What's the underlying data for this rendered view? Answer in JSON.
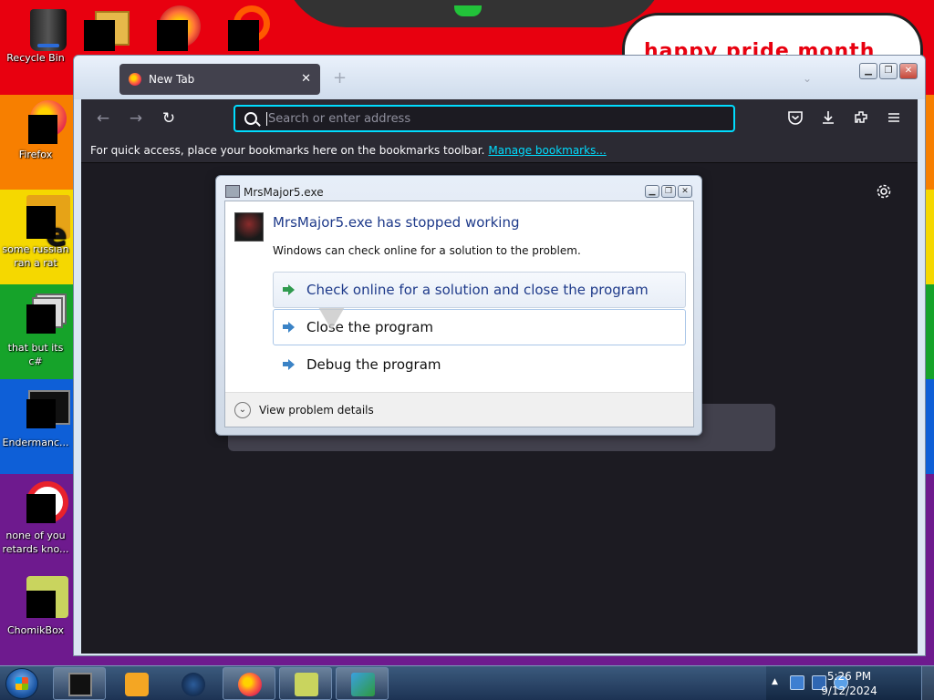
{
  "desktop": {
    "banner_text": "happy pride month",
    "icons": [
      {
        "label": "Recycle Bin",
        "icon": "recycle-bin-icon"
      },
      {
        "label": "Firefox",
        "icon": "firefox-icon"
      },
      {
        "label": "some russian ran a rat",
        "icon": "java-file-icon"
      },
      {
        "label": "that but its c#",
        "icon": "file-icon"
      },
      {
        "label": "Endermanc...",
        "icon": "terminal-icon"
      },
      {
        "label": "none of you retards kno...",
        "icon": "opera-icon"
      },
      {
        "label": "ChomikBox",
        "icon": "chomikbox-icon"
      }
    ]
  },
  "browser": {
    "tab_title": "New Tab",
    "tab_close": "✕",
    "new_tab": "+",
    "tab_list": "⌄",
    "back": "←",
    "forward": "→",
    "reload": "↻",
    "url_placeholder": "Search or enter address",
    "toolbar_icons": [
      "pocket-icon",
      "download-icon",
      "extensions-icon",
      "menu-icon"
    ],
    "bookmarks_prompt": "For quick access, place your bookmarks here on the bookmarks toolbar.",
    "manage_bookmarks": "Manage bookmarks...",
    "window_minimize": "▁",
    "window_restore": "❐",
    "window_close": "✕"
  },
  "dialog": {
    "title": "MrsMajor5.exe",
    "heading": "MrsMajor5.exe has stopped working",
    "description": "Windows can check online for a solution to the problem.",
    "options": [
      "Check online for a solution and close the program",
      "Close the program",
      "Debug the program"
    ],
    "details_toggle": "View problem details"
  },
  "taskbar": {
    "time": "5:26 PM",
    "date": "9/12/2024",
    "pinned": [
      "terminal",
      "media-player",
      "opera",
      "firefox",
      "chomikbox",
      "setup-installer"
    ],
    "tray_expand": "▲"
  },
  "colors": {
    "accent_focus": "#00ddff",
    "dialog_heading": "#1e3a8a",
    "browser_bg": "#1c1b22"
  }
}
